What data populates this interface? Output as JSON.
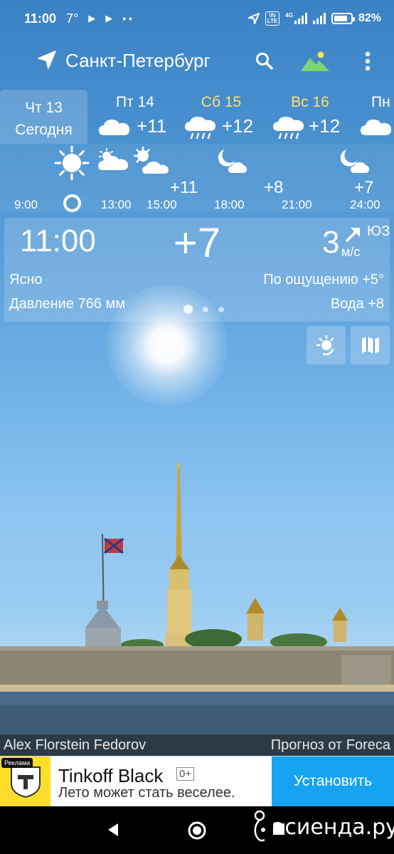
{
  "statusbar": {
    "time": "11:00",
    "temp": "7°",
    "net_top": "Vo",
    "net_bottom": "LTE",
    "net_gen": "4G",
    "battery_percent": "82%",
    "battery_level": 0.82
  },
  "header": {
    "city": "Санкт-Петербург",
    "icons": [
      "location-arrow-icon",
      "search-icon",
      "landscape-icon",
      "more-vert-icon"
    ]
  },
  "days": {
    "active": {
      "line1": "Чт 13",
      "line2": "Сегодня"
    },
    "items": [
      {
        "name": "Пт 14",
        "temp": "+11",
        "icon": "cloud-icon",
        "weekend": false
      },
      {
        "name": "Сб 15",
        "temp": "+12",
        "icon": "rain-cloud-icon",
        "weekend": true
      },
      {
        "name": "Вс 16",
        "temp": "+12",
        "icon": "rain-cloud-icon",
        "weekend": true
      },
      {
        "name": "Пн",
        "temp": "",
        "icon": "cloud-icon",
        "weekend": false
      }
    ]
  },
  "hourly": {
    "times": [
      "9:00",
      "13:00",
      "15:00",
      "18:00",
      "21:00",
      "24:00"
    ],
    "temps": [
      "+11",
      "+8",
      "+7"
    ]
  },
  "current": {
    "time": "11:00",
    "temp": "+7",
    "wind_speed": "3",
    "wind_dir": "ЮЗ",
    "wind_unit": "м/с",
    "condition": "Ясно",
    "feels_like": "По ощущению +5°",
    "pressure": "Давление 766 мм",
    "water": "Вода +8"
  },
  "credits": {
    "photo": "Alex Florstein Fedorov",
    "source": "Прогноз от Foreca"
  },
  "ad": {
    "tag": "Реклама",
    "title": "Tinkoff Black",
    "age": "0+",
    "subtitle": "Лето может стать веселее.",
    "button": "Установить"
  },
  "watermark": "асиенда.ру",
  "colors": {
    "sky_top": "#3a82c4",
    "weekend": "#ffe070",
    "ad_button": "#16a3f0",
    "ad_logo": "#ffdd2d"
  }
}
